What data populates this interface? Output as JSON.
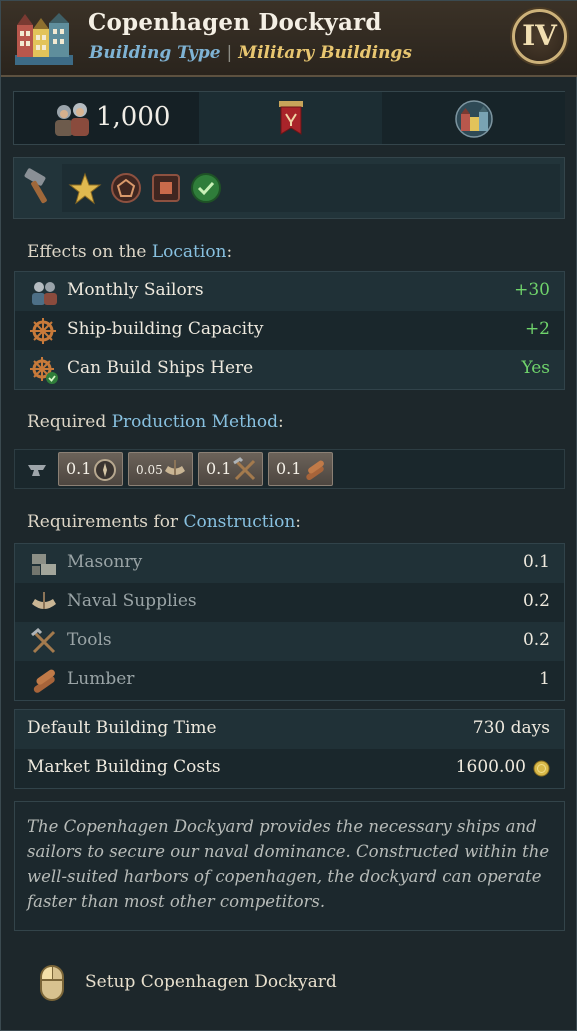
{
  "header": {
    "title": "Copenhagen Dockyard",
    "building_type_key": "Building Type",
    "separator": "|",
    "building_type_value": "Military Buildings",
    "tier": "IV",
    "icon": "town-houses-icon"
  },
  "stats": {
    "manpower_value": "1,000",
    "manpower_icon": "soldiers-icon",
    "middle_icon": "military-banner-icon",
    "right_icon": "town-houses-icon"
  },
  "icon_row": {
    "icons": [
      "hammer-icon",
      "star-icon",
      "pentagon-icon",
      "square-icon",
      "checkmark-icon"
    ]
  },
  "effects": {
    "heading_prefix": "Effects on the ",
    "heading_link": "Location",
    "heading_suffix": ":",
    "rows": [
      {
        "label": "Monthly Sailors",
        "value": "+30",
        "icon": "sailors-icon"
      },
      {
        "label": "Ship-building Capacity",
        "value": "+2",
        "icon": "ship-wheel-icon"
      },
      {
        "label": "Can Build Ships Here",
        "value": "Yes",
        "icon": "ship-wheel-check-icon"
      }
    ]
  },
  "production": {
    "heading_prefix": "Required ",
    "heading_link": "Production Method",
    "heading_suffix": ":",
    "method_icon": "anvil-icon",
    "chips": [
      {
        "value": "0.1",
        "icon": "compass-icon"
      },
      {
        "value": "0.05",
        "icon": "naval-supplies-icon"
      },
      {
        "value": "0.1",
        "icon": "tools-icon"
      },
      {
        "value": "0.1",
        "icon": "lumber-icon"
      }
    ]
  },
  "construction": {
    "heading_prefix": "Requirements for ",
    "heading_link": "Construction",
    "heading_suffix": ":",
    "rows": [
      {
        "label": "Masonry",
        "value": "0.1",
        "icon": "masonry-icon"
      },
      {
        "label": "Naval Supplies",
        "value": "0.2",
        "icon": "naval-supplies-icon"
      },
      {
        "label": "Tools",
        "value": "0.2",
        "icon": "tools-icon"
      },
      {
        "label": "Lumber",
        "value": "1",
        "icon": "lumber-icon"
      }
    ]
  },
  "costs": {
    "rows": [
      {
        "label": "Default Building Time",
        "value": "730 days"
      },
      {
        "label": "Market Building Costs",
        "value": "1600.00",
        "icon": "gold-coin-icon"
      }
    ]
  },
  "description": "The Copenhagen Dockyard provides the necessary ships and sailors to secure our naval dominance. Constructed within the well-suited harbors of copenhagen, the dockyard can operate faster than most other competitors.",
  "action": {
    "label": "Setup Copenhagen Dockyard",
    "icon": "mouse-icon"
  },
  "colors": {
    "accent_blue": "#88c1e0",
    "accent_gold": "#e8c670",
    "positive_green": "#6fd36b"
  }
}
